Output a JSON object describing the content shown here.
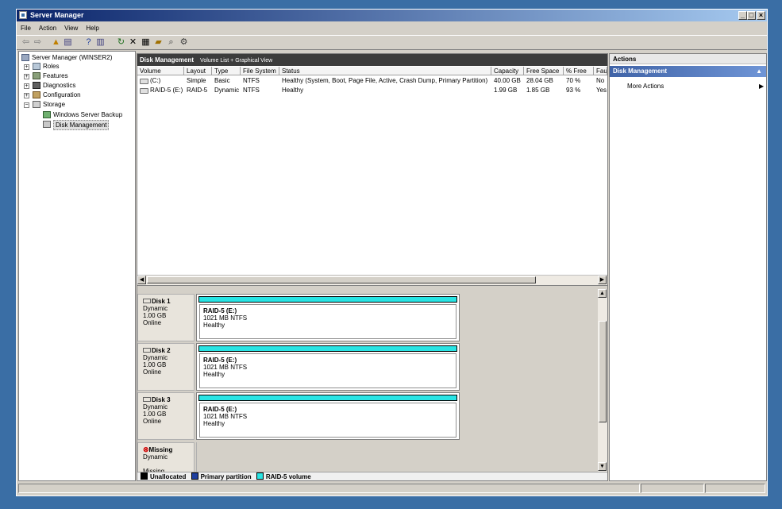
{
  "window": {
    "title": "Server Manager"
  },
  "menu": [
    "File",
    "Action",
    "View",
    "Help"
  ],
  "tree": {
    "root": "Server Manager (WINSER2)",
    "items": [
      "Roles",
      "Features",
      "Diagnostics",
      "Configuration",
      "Storage"
    ],
    "storage_children": [
      "Windows Server Backup",
      "Disk Management"
    ]
  },
  "center": {
    "header_title": "Disk Management",
    "header_sub": "Volume List + Graphical View",
    "columns": [
      "Volume",
      "Layout",
      "Type",
      "File System",
      "Status",
      "Capacity",
      "Free Space",
      "% Free",
      "Fau"
    ],
    "rows": [
      [
        "(C:)",
        "Simple",
        "Basic",
        "NTFS",
        "Healthy (System, Boot, Page File, Active, Crash Dump, Primary Partition)",
        "40.00 GB",
        "28.04 GB",
        "70 %",
        "No"
      ],
      [
        "RAID-5 (E:)",
        "RAID-5",
        "Dynamic",
        "NTFS",
        "Healthy",
        "1.99 GB",
        "1.85 GB",
        "93 %",
        "Yes"
      ]
    ]
  },
  "disks": [
    {
      "name": "Disk 1",
      "type": "Dynamic",
      "size": "1.00 GB",
      "state": "Online",
      "vol_name": "RAID-5  (E:)",
      "vol_size": "1021 MB NTFS",
      "vol_status": "Healthy"
    },
    {
      "name": "Disk 2",
      "type": "Dynamic",
      "size": "1.00 GB",
      "state": "Online",
      "vol_name": "RAID-5  (E:)",
      "vol_size": "1021 MB NTFS",
      "vol_status": "Healthy"
    },
    {
      "name": "Disk 3",
      "type": "Dynamic",
      "size": "1.00 GB",
      "state": "Online",
      "vol_name": "RAID-5  (E:)",
      "vol_size": "1021 MB NTFS",
      "vol_status": "Healthy"
    }
  ],
  "missing_disk": {
    "name": "Missing",
    "type": "Dynamic",
    "state": "Missing"
  },
  "legend": [
    {
      "label": "Unallocated",
      "color": "#000000"
    },
    {
      "label": "Primary partition",
      "color": "#1f3f9f"
    },
    {
      "label": "RAID-5 volume",
      "color": "#29e4e4"
    }
  ],
  "actions": {
    "header": "Actions",
    "section": "Disk Management",
    "items": [
      "More Actions"
    ]
  },
  "colors": {
    "raid_bar": "#29e4e4",
    "desktop": "#3a6ea5"
  }
}
